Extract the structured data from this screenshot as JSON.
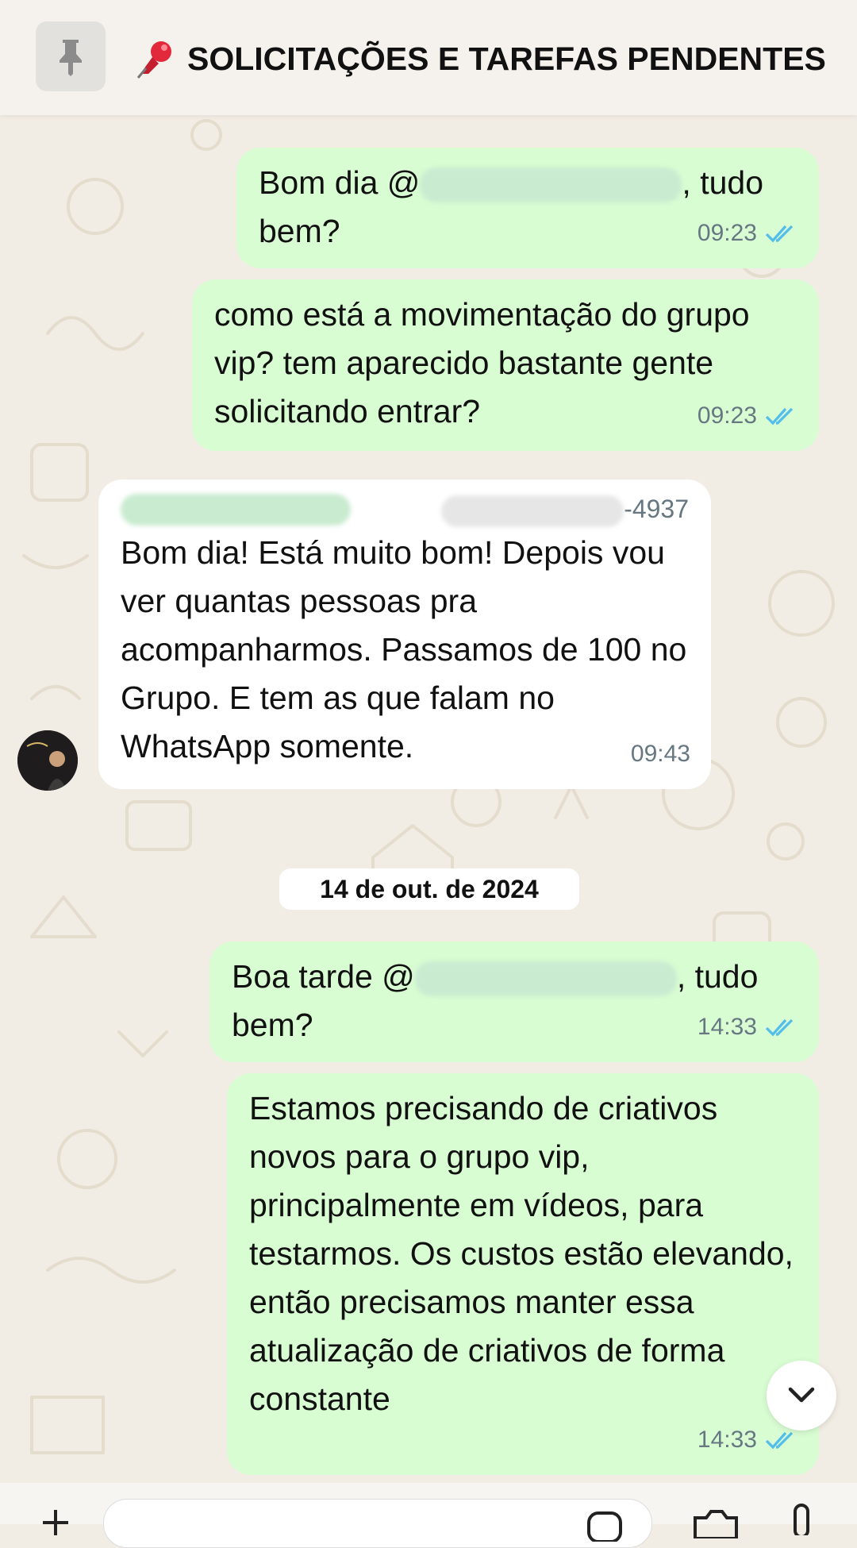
{
  "pinned": {
    "title": "SOLICITAÇÕES E TAREFAS PENDENTES",
    "pin_icon": "pin-icon",
    "emoji_icon": "pushpin-emoji-icon"
  },
  "messages": [
    {
      "direction": "out",
      "text_before": "Bom dia @",
      "text_after": ", tudo bem?",
      "time": "09:23",
      "status": "read"
    },
    {
      "direction": "out",
      "text": "como está a movimentação do grupo vip? tem aparecido bastante gente solicitando entrar?",
      "time": "09:23",
      "status": "read"
    },
    {
      "direction": "in",
      "sender_phone_suffix": "-4937",
      "text": "Bom dia! Está muito bom! Depois vou ver quantas pessoas pra acompanharmos. Passamos de 100 no Grupo. E tem as que falam no WhatsApp somente.",
      "time": "09:43"
    },
    {
      "direction": "out",
      "text_before": "Boa tarde @",
      "text_after": ", tudo bem?",
      "time": "14:33",
      "status": "read"
    },
    {
      "direction": "out",
      "text": "Estamos precisando de criativos novos para o grupo vip, principalmente em vídeos, para testarmos. Os custos estão elevando, então precisamos manter essa atualização de criativos de forma constante",
      "time": "14:33",
      "status": "read"
    }
  ],
  "date_separator": "14 de out. de 2024",
  "colors": {
    "outgoing_bubble": "#d9fdd3",
    "incoming_bubble": "#ffffff",
    "read_ticks": "#53bdeb",
    "background": "#f2ede4"
  }
}
